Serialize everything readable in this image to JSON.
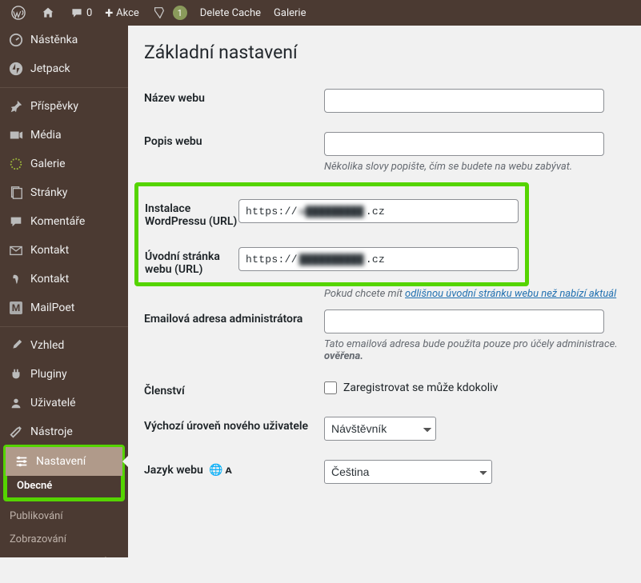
{
  "toolbar": {
    "site_name": "",
    "comments_count": "0",
    "new_label": "Akce",
    "seo_badge": "1",
    "delete_cache": "Delete Cache",
    "gallery": "Galerie"
  },
  "sidebar": {
    "items": [
      {
        "label": "Nástěnka"
      },
      {
        "label": "Jetpack"
      },
      {
        "label": "Příspěvky"
      },
      {
        "label": "Média"
      },
      {
        "label": "Galerie"
      },
      {
        "label": "Stránky"
      },
      {
        "label": "Komentáře"
      },
      {
        "label": "Kontakt"
      },
      {
        "label": "Kontakt"
      },
      {
        "label": "MailPoet"
      },
      {
        "label": "Vzhled"
      },
      {
        "label": "Pluginy"
      },
      {
        "label": "Uživatelé"
      },
      {
        "label": "Nástroje"
      },
      {
        "label": "Nastavení"
      }
    ],
    "submenu": [
      {
        "label": "Obecné"
      },
      {
        "label": "Publikování"
      },
      {
        "label": "Zobrazování"
      },
      {
        "label": "Nastavení komentářů"
      }
    ]
  },
  "page": {
    "title": "Základní nastavení",
    "labels": {
      "site_name": "Název webu",
      "tagline": "Popis webu",
      "wp_url": "Instalace WordPressu (URL)",
      "site_url": "Úvodní stránka webu (URL)",
      "admin_email": "Emailová adresa administrátora",
      "membership": "Členství",
      "default_role": "Výchozí úroveň nového uživatele",
      "site_lang": "Jazyk webu"
    },
    "values": {
      "site_name": "",
      "tagline": "",
      "wp_url_prefix": "https://",
      "wp_url_suffix": ".cz",
      "site_url_prefix": "https://",
      "site_url_suffix": ".cz",
      "admin_email": "",
      "default_role": "Návštěvník",
      "site_lang": "Čeština"
    },
    "desc": {
      "tagline": "Několika slovy popište, čím se budete na webu zabývat.",
      "site_url_pre": "Pokud chcete mít ",
      "site_url_link": "odlišnou úvodní stránku webu než nabízí aktuál",
      "admin_email_pre": "Tato emailová adresa bude použita pouze pro účely administrace. ",
      "admin_email_bold": "ověřena."
    },
    "membership_checkbox": "Zaregistrovat se může kdokoliv"
  }
}
